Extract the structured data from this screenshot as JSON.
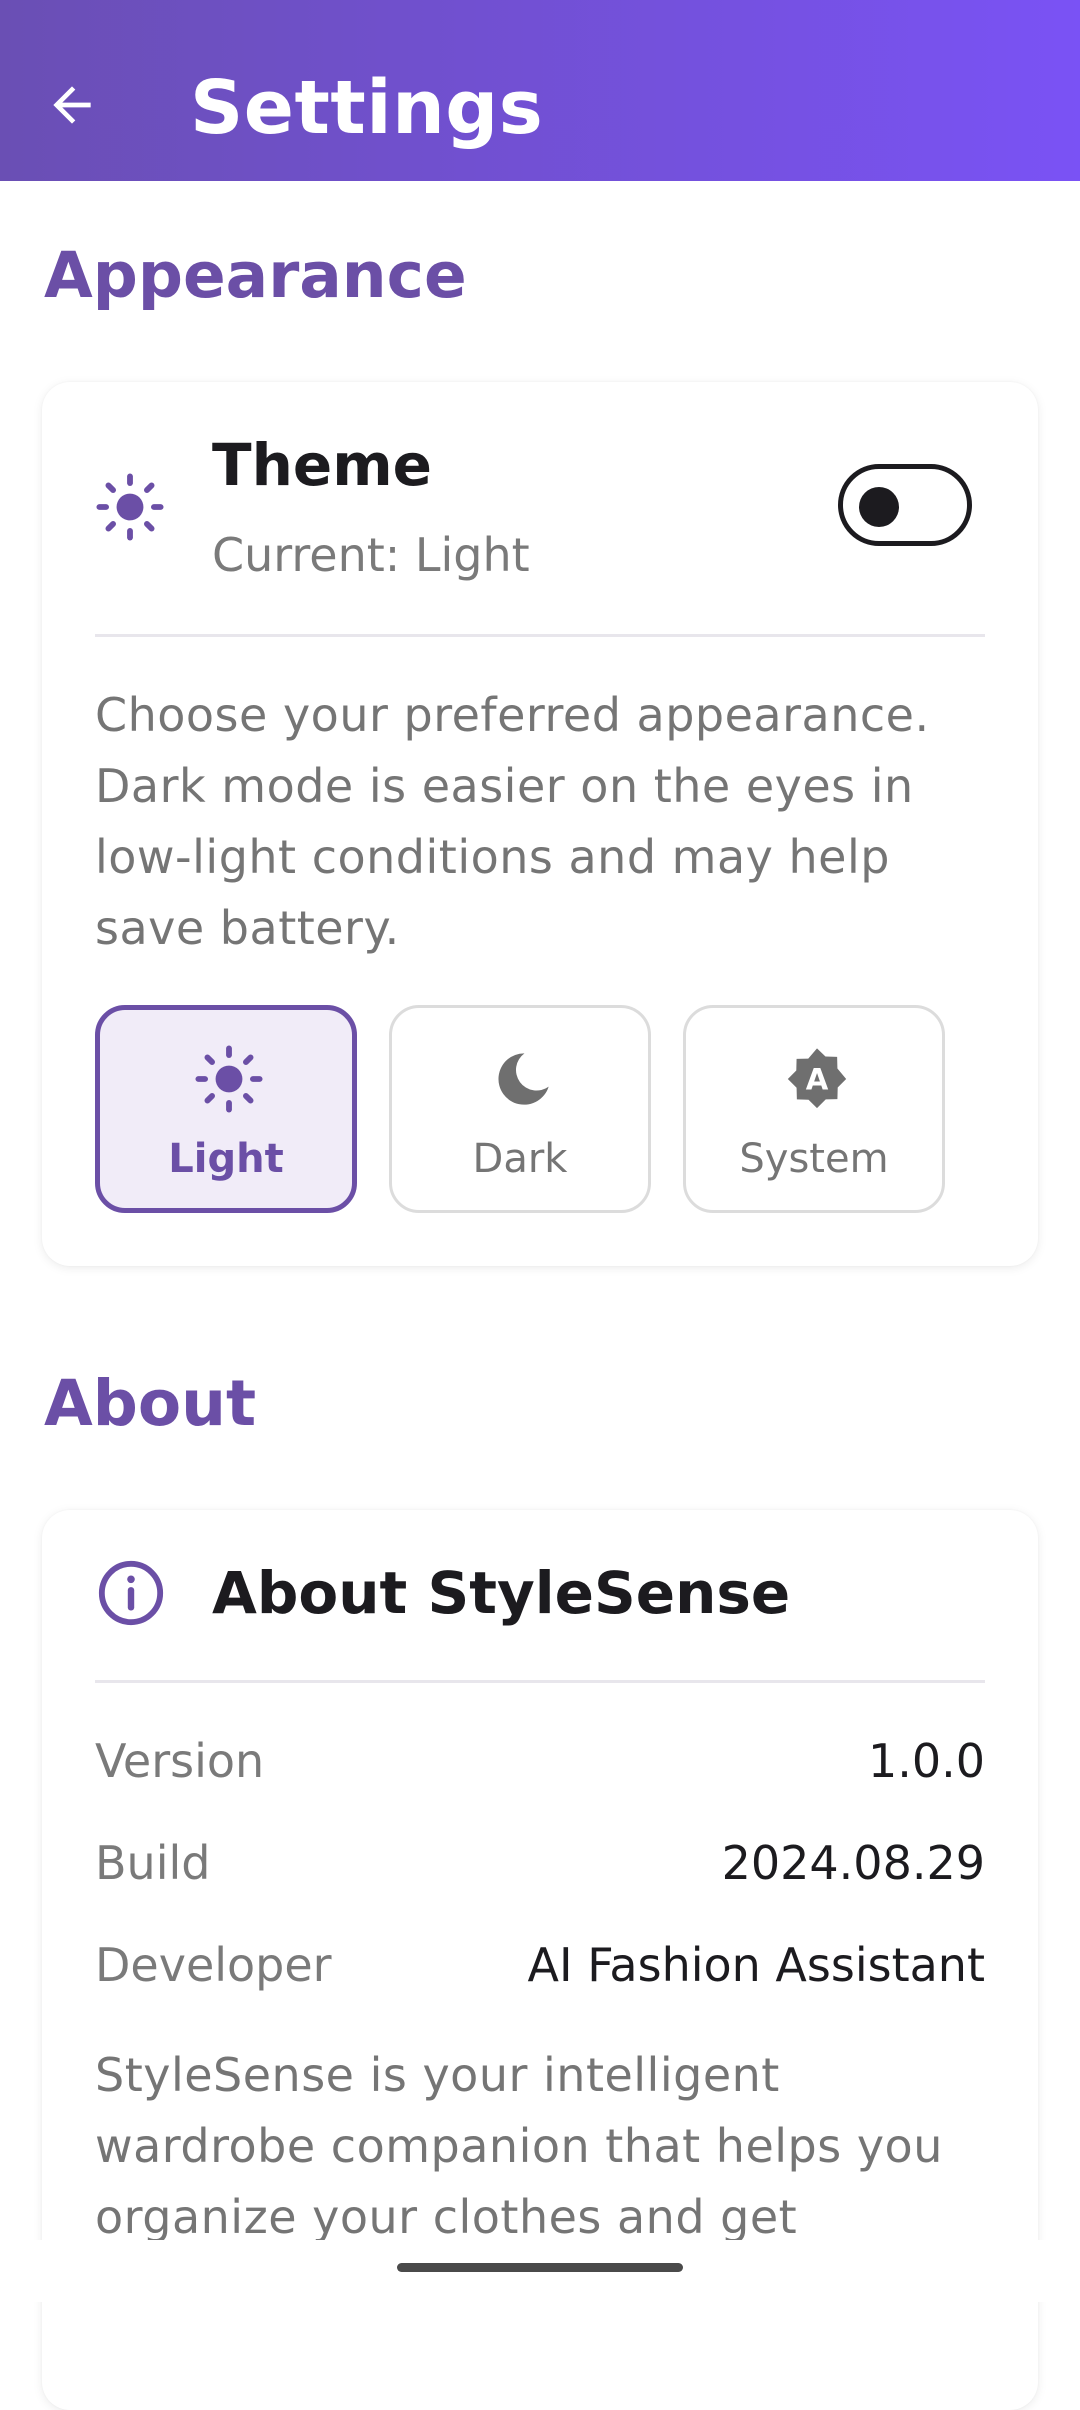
{
  "app_bar": {
    "title": "Settings",
    "back_icon": "arrow-left-icon"
  },
  "appearance": {
    "section_title": "Appearance",
    "theme": {
      "title": "Theme",
      "current": "Current: Light",
      "icon": "sun-icon",
      "toggle_on": false,
      "description": "Choose your preferred appearance. Dark mode is easier on the eyes in low-light conditions and may help save battery."
    },
    "options": [
      {
        "label": "Light",
        "icon": "sun-icon",
        "selected": true
      },
      {
        "label": "Dark",
        "icon": "moon-icon",
        "selected": false
      },
      {
        "label": "System",
        "icon": "auto-brightness-icon",
        "selected": false
      }
    ]
  },
  "about": {
    "section_title": "About",
    "card_title": "About StyleSense",
    "icon": "info-icon",
    "rows": [
      {
        "label": "Version",
        "value": "1.0.0"
      },
      {
        "label": "Build",
        "value": "2024.08.29"
      },
      {
        "label": "Developer",
        "value": "AI Fashion Assistant"
      }
    ],
    "description": "StyleSense is your intelligent wardrobe companion that helps you organize your clothes and get"
  },
  "colors": {
    "accent": "#6b4fa6",
    "appbar_start": "#6a4fb4",
    "appbar_end": "#7a52f5"
  }
}
